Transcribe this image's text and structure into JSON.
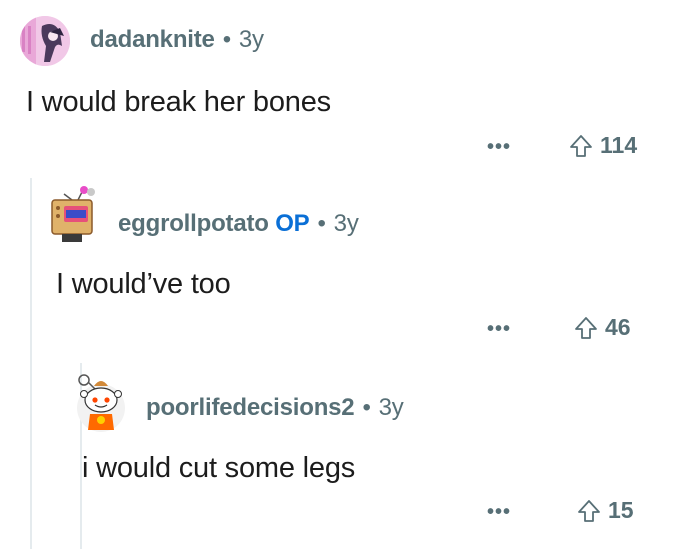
{
  "comments": [
    {
      "username": "dadanknite",
      "is_op": false,
      "age": "3y",
      "body": "I would break her bones",
      "votes": "114",
      "more_label": "•••"
    },
    {
      "username": "eggrollpotato",
      "is_op": true,
      "op_label": "OP",
      "age": "3y",
      "body": "I would’ve too",
      "votes": "46",
      "more_label": "•••"
    },
    {
      "username": "poorlifedecisions2",
      "is_op": false,
      "age": "3y",
      "body": "i would cut some legs",
      "votes": "15",
      "more_label": "•••"
    }
  ],
  "separator": "•",
  "icons": {
    "upvote": "upvote-arrow-icon",
    "more": "more-options-icon"
  },
  "colors": {
    "meta": "#576f76",
    "op_badge": "#0a6fd6",
    "text": "#1c1c1c"
  }
}
